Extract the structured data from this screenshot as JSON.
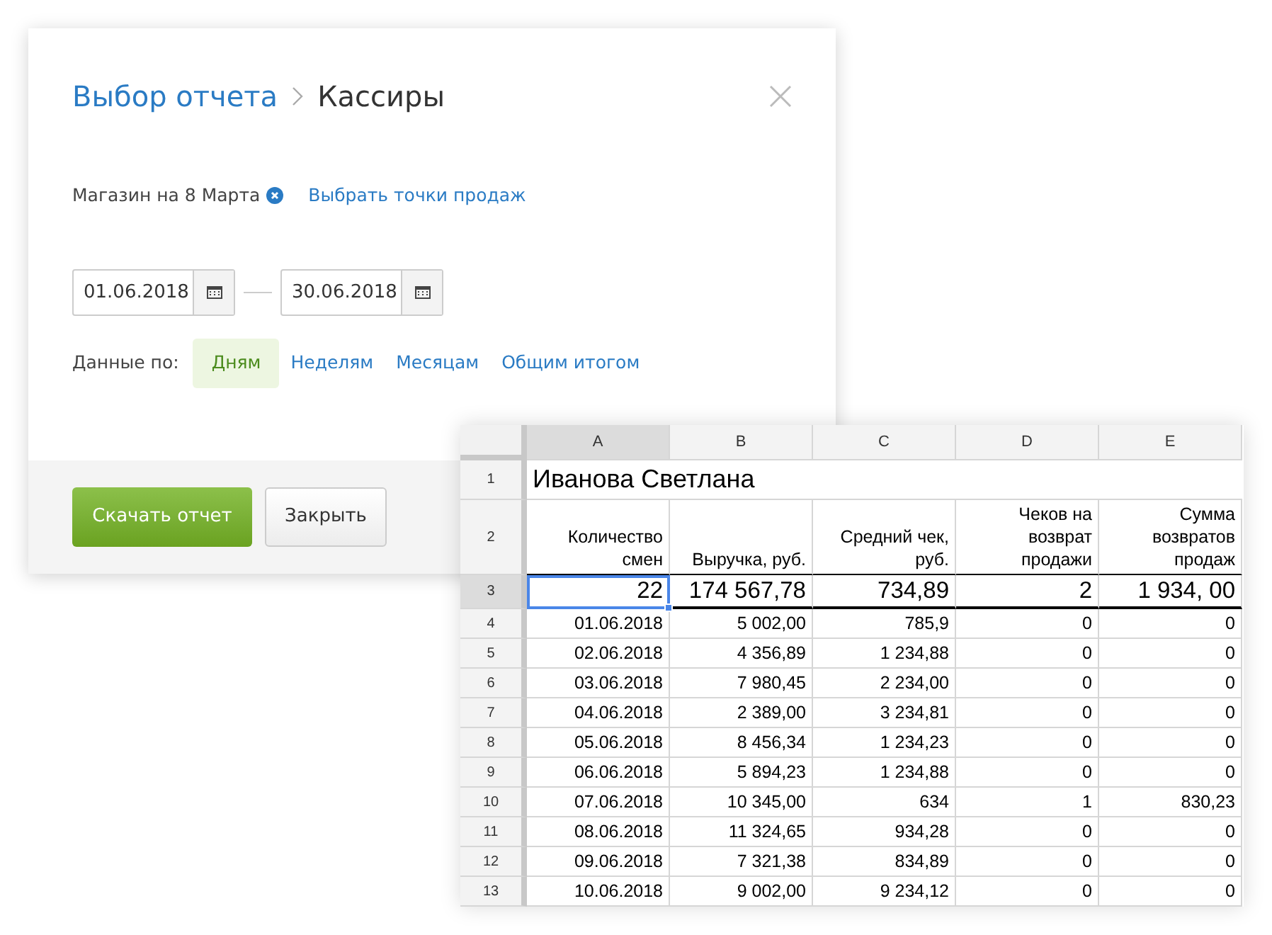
{
  "dialog": {
    "breadcrumb": "Выбор отчета",
    "title": "Кассиры",
    "store": {
      "label": "Магазин на 8 Марта"
    },
    "select_link": "Выбрать точки продаж",
    "date_from": "01.06.2018",
    "date_to": "30.06.2018",
    "group_label": "Данные по:",
    "periods": [
      {
        "label": "Дням",
        "selected": true
      },
      {
        "label": "Неделям",
        "selected": false
      },
      {
        "label": "Месяцам",
        "selected": false
      },
      {
        "label": "Общим итогом",
        "selected": false
      }
    ],
    "buttons": [
      {
        "label": "Скачать отчет",
        "kind": "primary"
      },
      {
        "label": "Закрыть",
        "kind": "secondary"
      }
    ]
  },
  "sheet": {
    "columns": [
      {
        "letter": "A",
        "selected": true
      },
      {
        "letter": "B",
        "selected": false
      },
      {
        "letter": "C",
        "selected": false
      },
      {
        "letter": "D",
        "selected": false
      },
      {
        "letter": "E",
        "selected": false
      }
    ],
    "rows": [
      {
        "number": "1",
        "kind": "title",
        "selected": false,
        "cells": [
          "Иванова Светлана"
        ]
      },
      {
        "number": "2",
        "kind": "header",
        "selected": false,
        "cells": [
          "Количество смен",
          "Выручка, руб.",
          "Средний чек, руб.",
          "Чеков на возврат продажи",
          "Сумма возвратов продаж"
        ]
      },
      {
        "number": "3",
        "kind": "total",
        "selected": true,
        "cells": [
          "22",
          "174 567,78",
          "734,89",
          "2",
          "1 934, 00"
        ]
      },
      {
        "number": "4",
        "kind": "data",
        "selected": false,
        "cells": [
          "01.06.2018",
          "5 002,00",
          "785,9",
          "0",
          "0"
        ]
      },
      {
        "number": "5",
        "kind": "data",
        "selected": false,
        "cells": [
          "02.06.2018",
          "4 356,89",
          "1 234,88",
          "0",
          "0"
        ]
      },
      {
        "number": "6",
        "kind": "data",
        "selected": false,
        "cells": [
          "03.06.2018",
          "7 980,45",
          "2 234,00",
          "0",
          "0"
        ]
      },
      {
        "number": "7",
        "kind": "data",
        "selected": false,
        "cells": [
          "04.06.2018",
          "2 389,00",
          "3 234,81",
          "0",
          "0"
        ]
      },
      {
        "number": "8",
        "kind": "data",
        "selected": false,
        "cells": [
          "05.06.2018",
          "8 456,34",
          "1 234,23",
          "0",
          "0"
        ]
      },
      {
        "number": "9",
        "kind": "data",
        "selected": false,
        "cells": [
          "06.06.2018",
          "5 894,23",
          "1 234,88",
          "0",
          "0"
        ]
      },
      {
        "number": "10",
        "kind": "data",
        "selected": false,
        "cells": [
          "07.06.2018",
          "10 345,00",
          "634",
          "1",
          "830,23"
        ]
      },
      {
        "number": "11",
        "kind": "data",
        "selected": false,
        "cells": [
          "08.06.2018",
          "11 324,65",
          "934,28",
          "0",
          "0"
        ]
      },
      {
        "number": "12",
        "kind": "data",
        "selected": false,
        "cells": [
          "09.06.2018",
          "7 321,38",
          "834,89",
          "0",
          "0"
        ]
      },
      {
        "number": "13",
        "kind": "data",
        "selected": false,
        "cells": [
          "10.06.2018",
          "9 002,00",
          "9 234,12",
          "0",
          "0"
        ]
      }
    ]
  }
}
